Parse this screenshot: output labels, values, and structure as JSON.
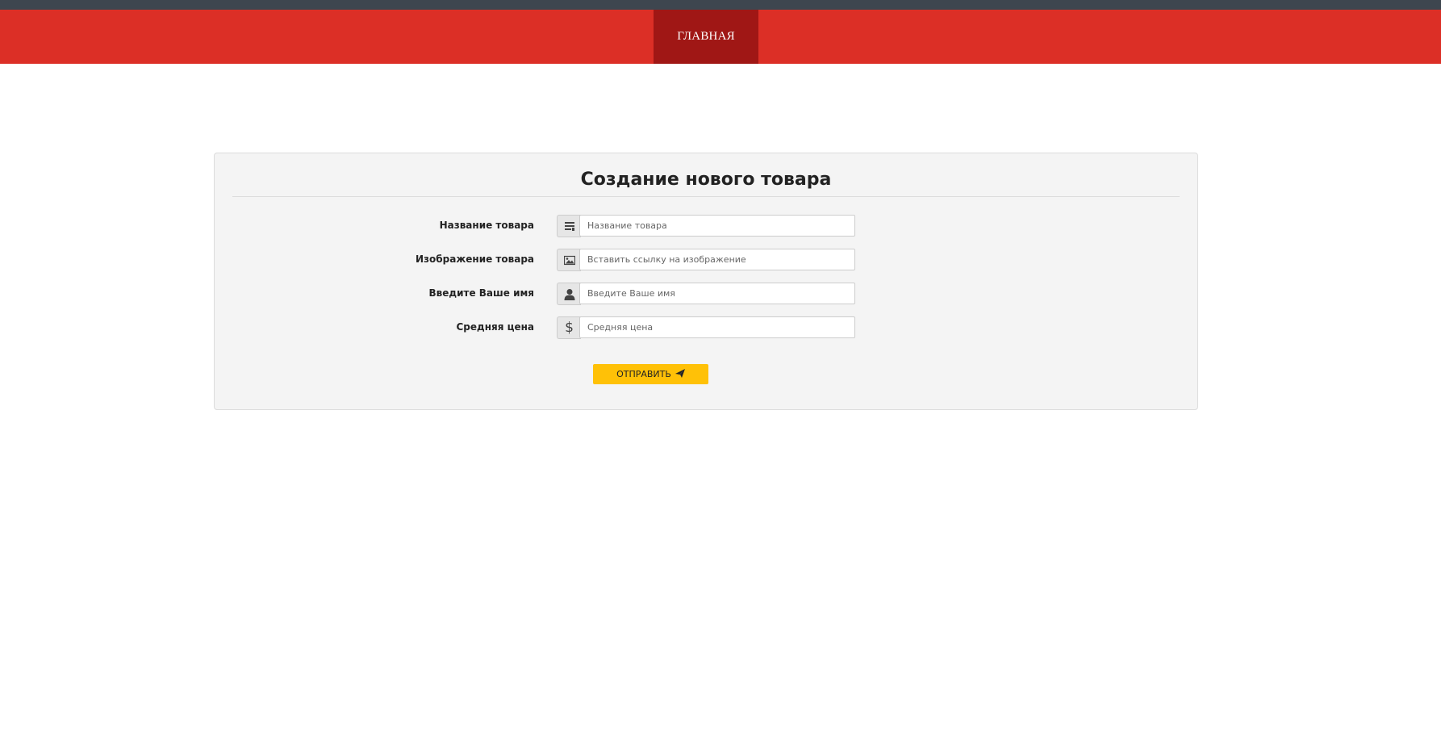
{
  "nav": {
    "home_label": "ГЛАВНАЯ"
  },
  "form": {
    "title": "Создание нового товара",
    "fields": [
      {
        "label": "Название товара",
        "placeholder": "Название товара",
        "icon": "list-icon"
      },
      {
        "label": "Изображение товара",
        "placeholder": "Вставить ссылку на изображение",
        "icon": "image-icon"
      },
      {
        "label": "Введите Ваше имя",
        "placeholder": "Введите Ваше имя",
        "icon": "user-icon"
      },
      {
        "label": "Средняя цена",
        "placeholder": "Средняя цена",
        "icon": "dollar-icon"
      }
    ],
    "submit_label": "ОТПРАВИТЬ",
    "submit_icon": "paper-plane-icon"
  },
  "colors": {
    "navbar": "#dc2f26",
    "nav_active": "#a01715",
    "topbar": "#3e464f",
    "submit": "#ffc107"
  }
}
